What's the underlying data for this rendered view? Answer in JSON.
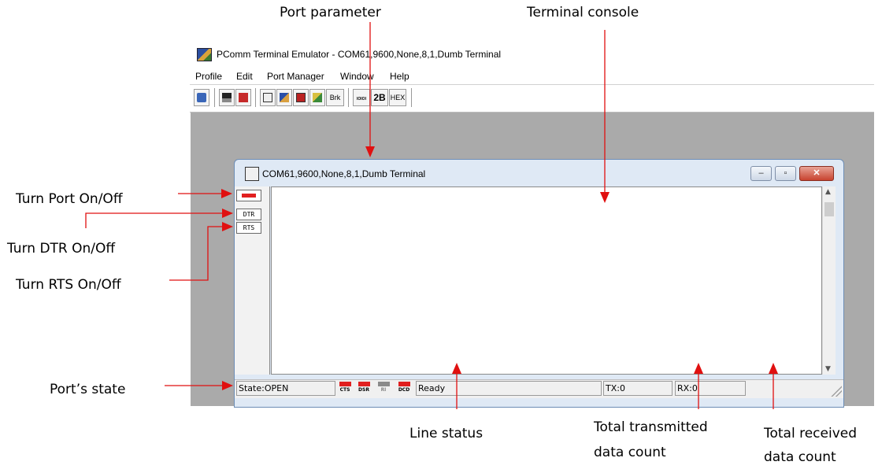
{
  "colors": {
    "accent_red": "#e11f1f",
    "led_off": "#8a8a8a",
    "mdi_background": "#aaaaaa",
    "window_frame": "#dfe9f5"
  },
  "app": {
    "title": "PComm Terminal Emulator - COM61,9600,None,8,1,Dumb Terminal",
    "menu": [
      "Profile",
      "Edit",
      "Port Manager",
      "Window",
      "Help"
    ],
    "toolbar": {
      "buttons": [
        {
          "name": "open-icon"
        },
        {
          "name": "save-icon"
        },
        {
          "name": "exit-icon"
        },
        {
          "name": "properties-icon"
        },
        {
          "name": "transfer-icon"
        },
        {
          "name": "capture-icon"
        },
        {
          "name": "macro-icon"
        },
        {
          "label": "Brk"
        },
        {
          "name": "scan-icon",
          "label": "IOIOI"
        },
        {
          "label": "2B"
        },
        {
          "label": "HEX"
        }
      ]
    }
  },
  "terminal": {
    "title": "COM61,9600,None,8,1,Dumb Terminal",
    "window_buttons": {
      "minimize": "–",
      "restore": "▫",
      "close": "✕"
    },
    "sidebar": {
      "dtr_label": "DTR",
      "rts_label": "RTS"
    },
    "status": {
      "state": "State:OPEN",
      "leds": [
        {
          "label": "CTS",
          "on": true
        },
        {
          "label": "DSR",
          "on": true
        },
        {
          "label": "RI",
          "on": false
        },
        {
          "label": "DCD",
          "on": true
        }
      ],
      "message": "Ready",
      "tx": "TX:0",
      "rx": "RX:0"
    }
  },
  "annotations": {
    "port_parameter": "Port parameter",
    "terminal_console": "Terminal console",
    "turn_port": "Turn Port On/Off",
    "turn_dtr": "Turn DTR On/Off",
    "turn_rts": "Turn RTS On/Off",
    "ports_state": "Port’s state",
    "line_status": "Line status",
    "total_tx_line1": "Total transmitted",
    "total_tx_line2": "data count",
    "total_rx_line1": "Total received",
    "total_rx_line2": "data count"
  }
}
